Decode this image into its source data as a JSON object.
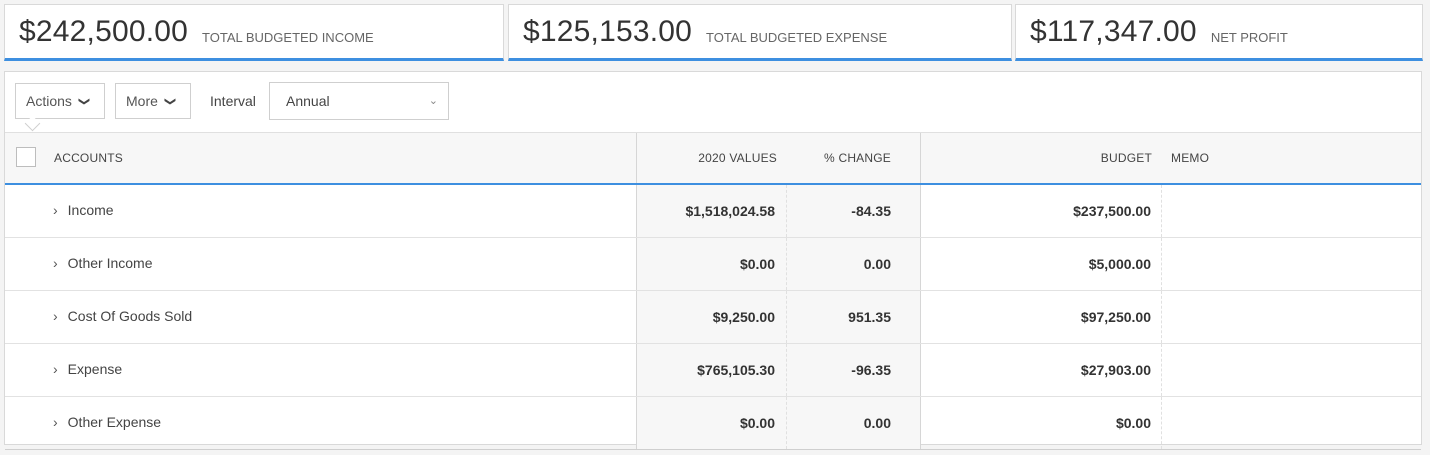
{
  "summary": [
    {
      "amount": "$242,500.00",
      "label": "TOTAL BUDGETED INCOME"
    },
    {
      "amount": "$125,153.00",
      "label": "TOTAL BUDGETED EXPENSE"
    },
    {
      "amount": "$117,347.00",
      "label": "NET PROFIT"
    }
  ],
  "toolbar": {
    "actions_label": "Actions",
    "more_label": "More",
    "interval_label": "Interval",
    "interval_value": "Annual"
  },
  "table": {
    "columns": {
      "accounts": "ACCOUNTS",
      "values": "2020 VALUES",
      "change": "% CHANGE",
      "budget": "BUDGET",
      "memo": "MEMO"
    },
    "rows": [
      {
        "account": "Income",
        "values": "$1,518,024.58",
        "change": "-84.35",
        "budget": "$237,500.00",
        "memo": ""
      },
      {
        "account": "Other Income",
        "values": "$0.00",
        "change": "0.00",
        "budget": "$5,000.00",
        "memo": ""
      },
      {
        "account": "Cost Of Goods Sold",
        "values": "$9,250.00",
        "change": "951.35",
        "budget": "$97,250.00",
        "memo": ""
      },
      {
        "account": "Expense",
        "values": "$765,105.30",
        "change": "-96.35",
        "budget": "$27,903.00",
        "memo": ""
      },
      {
        "account": "Other Expense",
        "values": "$0.00",
        "change": "0.00",
        "budget": "$0.00",
        "memo": ""
      }
    ]
  },
  "colors": {
    "accent": "#3d8fe0",
    "background": "#f4f4f4"
  },
  "icons": {
    "chevron": "chevron-down-icon",
    "expand": "chevron-right-icon",
    "caret": "caret-down-icon"
  }
}
